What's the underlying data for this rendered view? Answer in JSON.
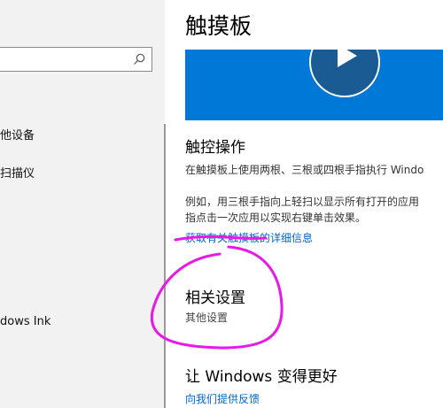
{
  "sidebar": {
    "search": {
      "placeholder": ""
    },
    "items": [
      {
        "label": "他设备"
      },
      {
        "label": "扫描仪"
      },
      {
        "label": "dows Ink"
      }
    ]
  },
  "main": {
    "title": "触摸板",
    "gestures_section": {
      "title": "触控操作",
      "line1": "在触摸板上使用两根、三根或四根手指执行 Windo",
      "line2": "例如，用三根手指向上轻扫以显示所有打开的应用",
      "line3": "指点击一次应用以实现右键单击效果。",
      "link": "获取有关触摸板的详细信息"
    },
    "related_section": {
      "title": "相关设置",
      "link": "其他设置"
    },
    "feedback_section": {
      "title": "让 Windows 变得更好",
      "link": "向我们提供反馈"
    }
  },
  "colors": {
    "accent": "#0078d7",
    "link": "#0066cc",
    "annotation": "#e818e8",
    "sidebar_bg": "#f2f2f2"
  }
}
